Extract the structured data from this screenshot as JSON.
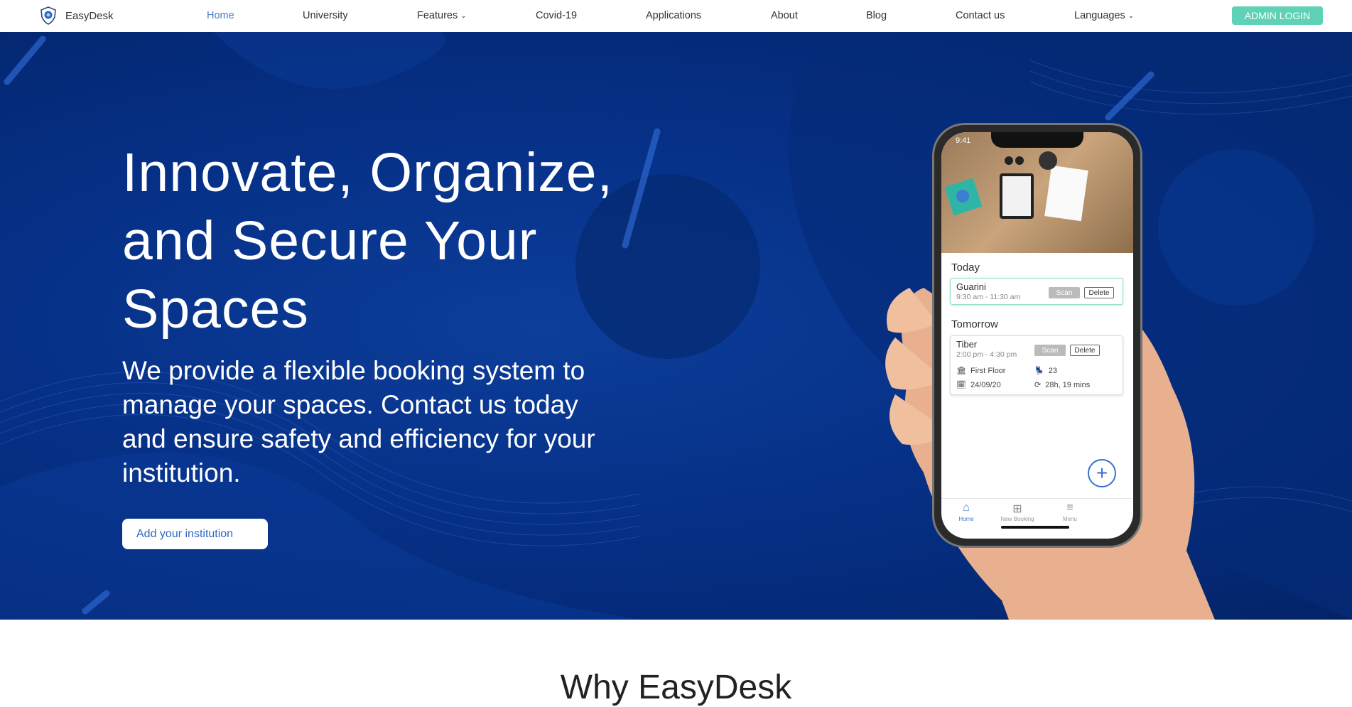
{
  "brand": {
    "name": "EasyDesk"
  },
  "nav": {
    "items": [
      {
        "label": "Home",
        "active": true
      },
      {
        "label": "University"
      },
      {
        "label": "Features",
        "dropdown": true
      },
      {
        "label": "Covid-19"
      },
      {
        "label": "Applications"
      },
      {
        "label": "About"
      },
      {
        "label": "Blog"
      },
      {
        "label": "Contact us"
      },
      {
        "label": "Languages",
        "dropdown": true
      }
    ],
    "admin_login": "ADMIN LOGIN"
  },
  "hero": {
    "title": "Innovate, Organize, and Secure Your Spaces",
    "subtitle": "We provide a flexible booking system to manage your spaces. Contact us today and ensure safety and efficiency for your institution.",
    "cta": "Add your institution"
  },
  "phone": {
    "status_time": "9:41",
    "today_label": "Today",
    "today_booking": {
      "name": "Guarini",
      "time": "9:30 am - 11:30 am",
      "scan": "Scan",
      "delete": "Delete"
    },
    "tomorrow_label": "Tomorrow",
    "tomorrow_booking": {
      "name": "Tiber",
      "time": "2:00 pm - 4:30 pm",
      "scan": "Scan",
      "delete": "Delete",
      "floor": "First Floor",
      "seat": "23",
      "date": "24/09/20",
      "duration": "28h, 19 mins"
    },
    "tabs": [
      {
        "label": "Home",
        "icon": "home-icon"
      },
      {
        "label": "New Booking",
        "icon": "plus-square-icon"
      },
      {
        "label": "Menu",
        "icon": "menu-icon"
      }
    ]
  },
  "sections": {
    "why_title": "Why EasyDesk"
  },
  "colors": {
    "accent": "#5fd1b7",
    "nav_active": "#4a7cc7",
    "hero_bg": "#07328a"
  }
}
